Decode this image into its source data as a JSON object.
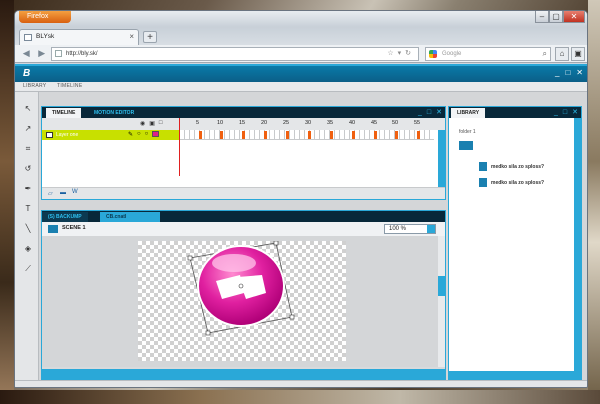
{
  "browser": {
    "menu_button": "Firefox",
    "tab_title": "BLYsk",
    "url": "http://bly.sk/",
    "search_placeholder": "Google",
    "window_controls": [
      "minimize-icon",
      "maximize-icon",
      "close-icon"
    ]
  },
  "app": {
    "logo_text": "B",
    "menu": [
      "LIBRARY",
      "TIMELINE"
    ]
  },
  "timeline_panel": {
    "tabs": [
      "TIMELINE",
      "MOTION EDITOR"
    ],
    "layer_name": "Layer one",
    "ruler": [
      "5",
      "10",
      "15",
      "20",
      "25",
      "30",
      "35",
      "40",
      "45",
      "50",
      "55"
    ]
  },
  "stage_panel": {
    "tabs": [
      "(S) BACKUMP",
      "CB.cnatI"
    ],
    "scene": "SCENE 1",
    "zoom": "100 %"
  },
  "library_panel": {
    "tab": "LIBRARY",
    "folder": "folder 1",
    "items": [
      "medko sila zo sploss?",
      "medko sila zo sploss?"
    ]
  },
  "colors": {
    "accent": "#2aa8d8",
    "header": "#0b5f88",
    "layer": "#c8e000",
    "symbol": "#e020a0"
  }
}
